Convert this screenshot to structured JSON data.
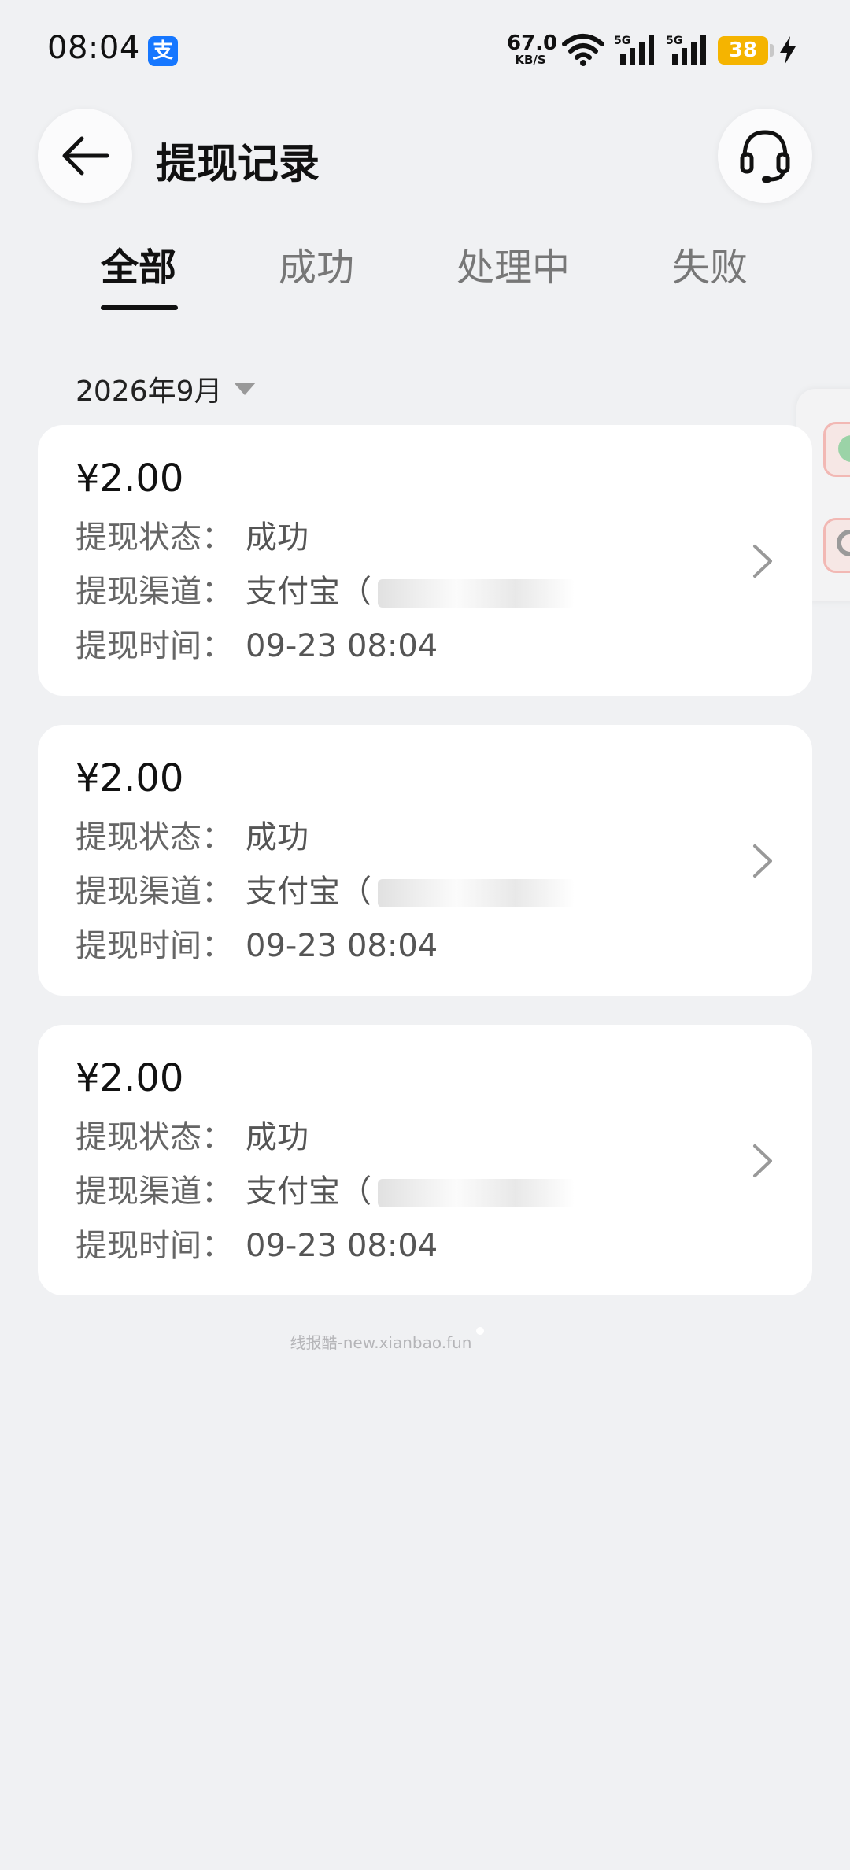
{
  "status_bar": {
    "time": "08:04",
    "net_speed_value": "67.0",
    "net_speed_unit": "KB/S",
    "signal_1_label": "5G",
    "signal_2_label": "5G",
    "battery_level": "38",
    "alipay_icon_glyph": "支"
  },
  "header": {
    "title": "提现记录",
    "back_icon": "arrow-left-icon",
    "service_icon": "headset-icon"
  },
  "tabs": [
    {
      "label": "全部",
      "active": true
    },
    {
      "label": "成功",
      "active": false
    },
    {
      "label": "处理中",
      "active": false
    },
    {
      "label": "失败",
      "active": false
    }
  ],
  "filter": {
    "month": "2026年9月"
  },
  "records": [
    {
      "amount": "¥2.00",
      "status_label": "提现状态：",
      "status_value": "成功",
      "channel_label": "提现渠道：",
      "channel_value": "支付宝（",
      "time_label": "提现时间：",
      "time_value": "09-23 08:04"
    },
    {
      "amount": "¥2.00",
      "status_label": "提现状态：",
      "status_value": "成功",
      "channel_label": "提现渠道：",
      "channel_value": "支付宝（",
      "time_label": "提现时间：",
      "time_value": "09-23 08:04"
    },
    {
      "amount": "¥2.00",
      "status_label": "提现状态：",
      "status_value": "成功",
      "channel_label": "提现渠道：",
      "channel_value": "支付宝（",
      "time_label": "提现时间：",
      "time_value": "09-23 08:04"
    }
  ],
  "watermark": "线报酷-new.xianbao.fun",
  "colors": {
    "background": "#f0f1f3",
    "card": "#ffffff",
    "battery": "#f5b400",
    "alipay": "#1677ff"
  }
}
